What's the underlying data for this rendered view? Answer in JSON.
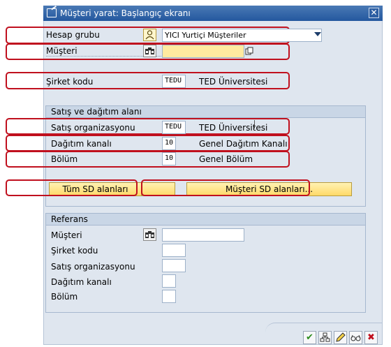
{
  "window": {
    "title": "Müşteri yarat: Başlangıç ekranı",
    "close_glyph": "✕"
  },
  "fields": {
    "account_group": {
      "label": "Hesap grubu",
      "value": "YICI Yurtiçi Müşteriler"
    },
    "customer": {
      "label": "Müşteri",
      "value": ""
    },
    "company_code": {
      "label": "Şirket kodu",
      "value": "TEDU",
      "description": "TED Üniversitesi"
    }
  },
  "sales_area": {
    "header": "Satış ve dağıtım alanı",
    "sales_org": {
      "label": "Satış organizasyonu",
      "value": "TEDU",
      "description": "TED Üniversitesi"
    },
    "distribution_channel": {
      "label": "Dağıtım kanalı",
      "value": "10",
      "description": "Genel Dağıtım Kanalı"
    },
    "division": {
      "label": "Bölüm",
      "value": "10",
      "description": "Genel Bölüm"
    }
  },
  "buttons": {
    "all_sd_areas": "Tüm SD alanları",
    "customer_sd_areas": "Müşteri SD alanları..."
  },
  "reference": {
    "header": "Referans",
    "customer": "Müşteri",
    "company_code": "Şirket kodu",
    "sales_org": "Satış organizasyonu",
    "distribution_channel": "Dağıtım kanalı",
    "division": "Bölüm"
  },
  "footer": {
    "enter": "✔",
    "cancel": "✖"
  },
  "icons": [
    "edit-icon",
    "close-icon",
    "person-icon",
    "binoculars-icon",
    "copy-icon",
    "dropdown-icon",
    "checkmark-icon",
    "hierarchy-icon",
    "pencil-icon",
    "glasses-icon",
    "cancel-icon"
  ],
  "colors": {
    "titlebar": "#24589f",
    "background": "#dfe6ef",
    "highlight": "#c0101e",
    "button": "#ffd968",
    "required_field": "#ffeaa0"
  }
}
